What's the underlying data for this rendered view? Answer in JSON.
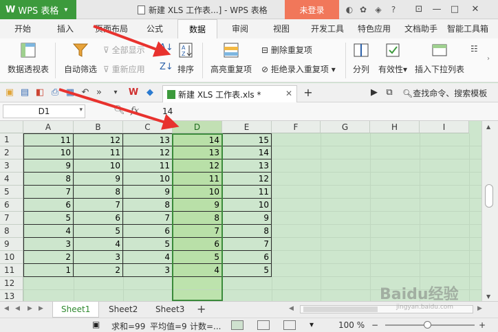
{
  "app": {
    "name": "WPS 表格",
    "window_title": "新建 XLS 工作表...] - WPS 表格",
    "login": "未登录"
  },
  "tabs": [
    "开始",
    "插入",
    "页面布局",
    "公式",
    "数据",
    "审阅",
    "视图",
    "开发工具",
    "特色应用",
    "文档助手",
    "智能工具箱"
  ],
  "active_tab": "数据",
  "ribbon": {
    "pivot": "数据透视表",
    "autofilter": "自动筛选",
    "show_all": "全部显示",
    "reapply": "重新应用",
    "sort": "排序",
    "highlight_dup": "高亮重复项",
    "remove_dup": "删除重复项",
    "reject_dup": "拒绝录入重复项",
    "split": "分列",
    "validation": "有效性",
    "insert_dropdown": "插入下拉列表"
  },
  "document_tab": {
    "name": "新建 XLS 工作表.xls *"
  },
  "command_search": "查找命令、搜索模板",
  "formula_bar": {
    "cell_ref": "D1",
    "fx": "fx",
    "value": "14"
  },
  "columns": [
    "A",
    "B",
    "C",
    "D",
    "E",
    "F",
    "G",
    "H",
    "I"
  ],
  "selected_column": "D",
  "rows": [
    [
      11,
      12,
      13,
      14,
      15
    ],
    [
      10,
      11,
      12,
      13,
      14
    ],
    [
      9,
      10,
      11,
      12,
      13
    ],
    [
      8,
      9,
      10,
      11,
      12
    ],
    [
      7,
      8,
      9,
      10,
      11
    ],
    [
      6,
      7,
      8,
      9,
      10
    ],
    [
      5,
      6,
      7,
      8,
      9
    ],
    [
      4,
      5,
      6,
      7,
      8
    ],
    [
      3,
      4,
      5,
      6,
      7
    ],
    [
      2,
      3,
      4,
      5,
      6
    ],
    [
      1,
      2,
      3,
      4,
      5
    ]
  ],
  "row_numbers": [
    "1",
    "2",
    "3",
    "4",
    "5",
    "6",
    "7",
    "8",
    "9",
    "10",
    "11",
    "12",
    "13"
  ],
  "sheets": [
    "Sheet1",
    "Sheet2",
    "Sheet3"
  ],
  "active_sheet": "Sheet1",
  "status": {
    "sum": "求和=99",
    "average": "平均值=9",
    "count": "计数=...",
    "zoom": "100 %"
  },
  "watermark": {
    "brand": "Baidu经验",
    "url": "jingyan.baidu.com"
  },
  "colors": {
    "accent_green": "#3c9a3c",
    "login_orange": "#f1775a",
    "arrow_red": "#e8322e",
    "selected_column_fill": "#bde3ad"
  }
}
